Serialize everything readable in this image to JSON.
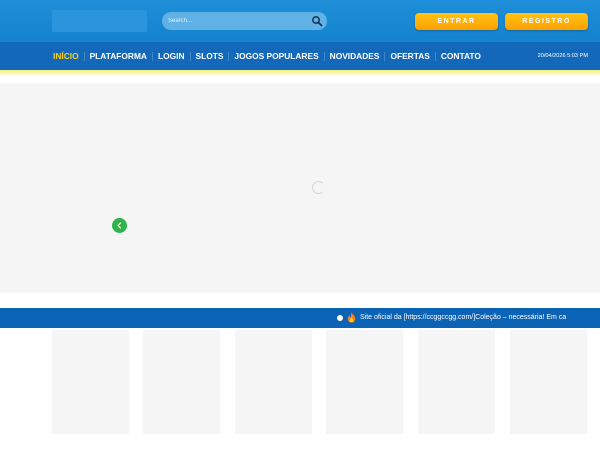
{
  "header": {
    "search": {
      "placeholder": "Search...",
      "value": ""
    },
    "buttons": {
      "entrar": "ENTRAR",
      "registro": "REGISTRO"
    }
  },
  "nav": {
    "items": [
      {
        "label": "INÍCIO",
        "active": true
      },
      {
        "label": "PLATAFORMA",
        "active": false
      },
      {
        "label": "LOGIN",
        "active": false
      },
      {
        "label": "SLOTS",
        "active": false
      },
      {
        "label": "JOGOS POPULARES",
        "active": false
      },
      {
        "label": "NOVIDADES",
        "active": false
      },
      {
        "label": "OFERTAS",
        "active": false
      },
      {
        "label": "CONTATO",
        "active": false
      }
    ],
    "datetime": "20/04/2026 5:03 PM"
  },
  "ticker": {
    "text": "Site oficial da [https://ccggccgg.com/]Coleção – necessária! Em ca"
  },
  "icons": {
    "search": "search-icon",
    "fire": "fire-icon",
    "loading": "loading-spinner-icon",
    "prev": "chevron-left-icon"
  },
  "colors": {
    "header_bg": "#1e8fd8",
    "nav_bg": "#1468b9",
    "nav_active": "#f6d21c",
    "button": "#ffb000",
    "ticker_bg": "#0b63b5",
    "prev_button": "#2fb34a"
  }
}
